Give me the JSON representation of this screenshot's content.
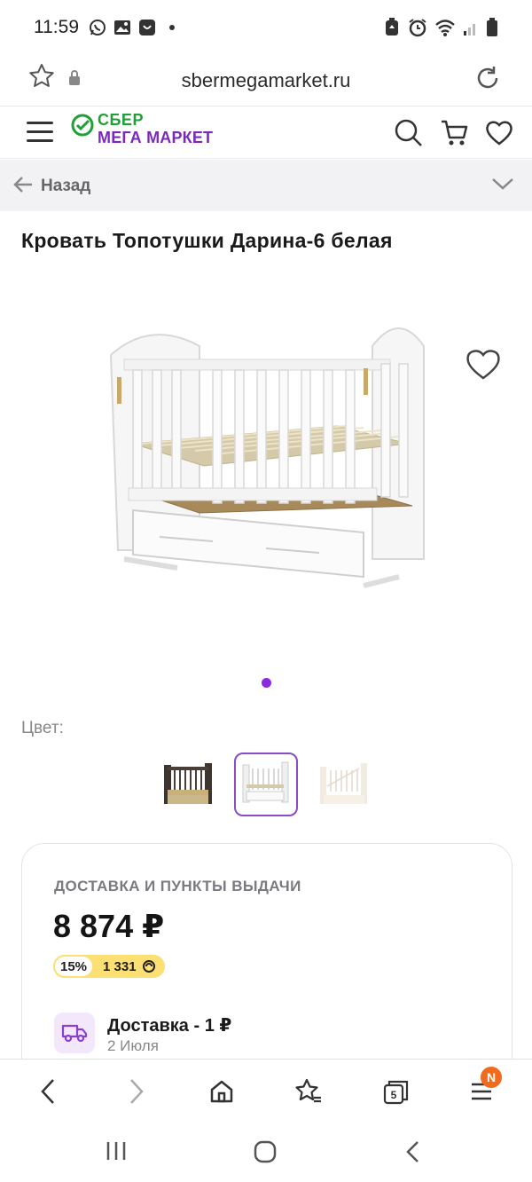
{
  "status_bar": {
    "time": "11:59"
  },
  "browser": {
    "url": "sbermegamarket.ru",
    "tab_count": "5",
    "menu_badge": "N"
  },
  "header": {
    "logo_line1": "СБЕР",
    "logo_line2": "МЕГА МАРКЕТ"
  },
  "back_bar": {
    "label": "Назад"
  },
  "product": {
    "title": "Кровать Топотушки Дарина-6 белая",
    "color_label": "Цвет:",
    "colors": [
      {
        "name": "dark",
        "accent": "#4a3f38",
        "selected": false
      },
      {
        "name": "white",
        "accent": "#ffffff",
        "selected": true
      },
      {
        "name": "ivory",
        "accent": "#f4ede2",
        "selected": false
      }
    ],
    "image_count": 1,
    "active_image": 1
  },
  "delivery_card": {
    "heading": "ДОСТАВКА И ПУНКТЫ ВЫДАЧИ",
    "price": "8 874 ₽",
    "bonus_percent": "15%",
    "bonus_amount": "1 331",
    "delivery_title": "Доставка - 1 ₽",
    "delivery_date": "2 Июля"
  },
  "colors": {
    "accent": "#8a2be2",
    "sber_green": "#21a038",
    "mega_purple": "#7b2ab8",
    "bonus_yellow": "#fde073",
    "badge_orange": "#f26a1b"
  }
}
